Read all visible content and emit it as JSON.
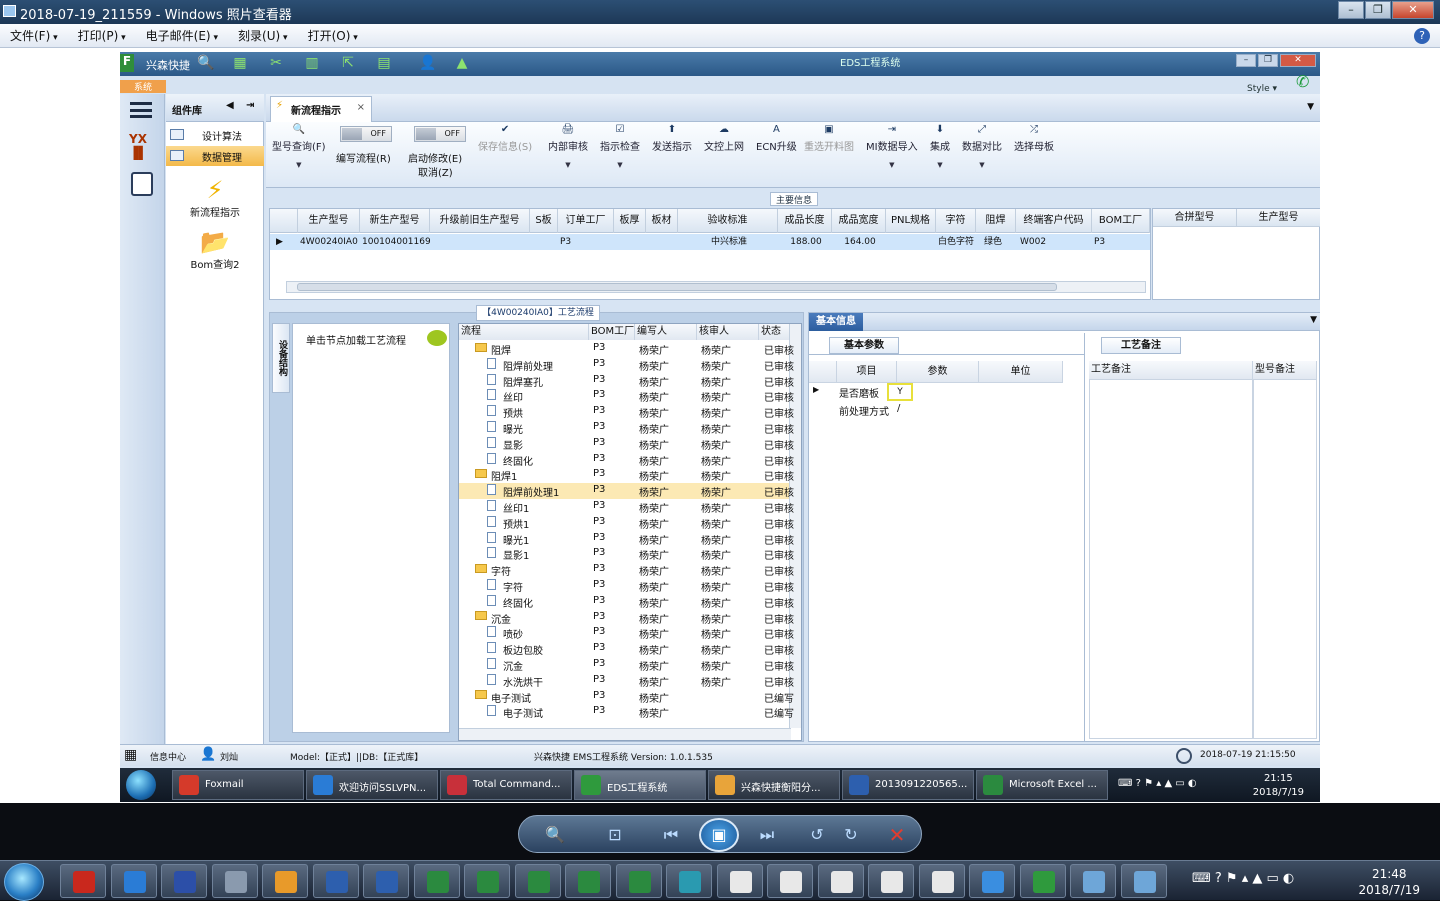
{
  "viewer": {
    "title": "2018-07-19_211559 - Windows 照片查看器",
    "menu": [
      "文件(F)",
      "打印(P)",
      "电子邮件(E)",
      "刻录(U)",
      "打开(O)"
    ]
  },
  "app": {
    "brand": "兴森快捷",
    "window_title": "EDS工程系统",
    "system_tab": "系统",
    "style_label": "Style ▾",
    "component_panel": {
      "title": "组件库",
      "items": [
        "设计算法",
        "数据管理"
      ],
      "shortcuts": [
        "新流程指示",
        "Bom查询2"
      ]
    },
    "doc_tab": "新流程指示",
    "ribbon": {
      "buttons": [
        {
          "label": "型号查询(F)",
          "icon": "🔍"
        },
        {
          "label": "编写流程(R)",
          "toggle": "OFF"
        },
        {
          "label": "启动修改(E)",
          "label2": "取消(Z)",
          "toggle": "OFF"
        },
        {
          "label": "保存信息(S)",
          "icon": "✔",
          "disabled": true
        },
        {
          "label": "内部审核",
          "icon": "🖨"
        },
        {
          "label": "指示检查",
          "icon": "☑"
        },
        {
          "label": "发送指示",
          "icon": "⬆"
        },
        {
          "label": "文控上网",
          "icon": "☁"
        },
        {
          "label": "ECN升级",
          "icon": "A"
        },
        {
          "label": "重选开料图",
          "icon": "▣",
          "disabled": true
        },
        {
          "label": "MI数据导入",
          "icon": "⇥"
        },
        {
          "label": "集成",
          "icon": "⬇"
        },
        {
          "label": "数据对比",
          "icon": "⤢"
        },
        {
          "label": "选择母板",
          "icon": "⤮"
        }
      ]
    },
    "main_info": {
      "title": "主要信息",
      "columns": [
        "生产型号",
        "新生产型号",
        "升级前旧生产型号",
        "S板",
        "订单工厂",
        "板厚",
        "板材",
        "验收标准",
        "成品长度",
        "成品宽度",
        "PNL规格",
        "字符",
        "阻焊",
        "终端客户代码",
        "BOM工厂"
      ],
      "row": [
        "4W00240IA0",
        "10010400116961",
        "",
        "",
        "P3",
        "",
        "",
        "中兴标准",
        "188.00",
        "164.00",
        "",
        "白色字符",
        "绿色",
        "W002",
        "P3"
      ],
      "side_columns": [
        "合拼型号",
        "生产型号"
      ]
    },
    "flow": {
      "title": "【4W00240IA0】工艺流程",
      "vertical_tab": "设备结构",
      "hint": "单击节点加载工艺流程",
      "columns": [
        "流程",
        "BOM工厂",
        "编写人",
        "核审人",
        "状态"
      ],
      "rows": [
        {
          "name": "阻焊",
          "level": 0,
          "folder": true,
          "bom": "P3",
          "writer": "杨荣广",
          "reviewer": "杨荣广",
          "status": "已审核"
        },
        {
          "name": "阻焊前处理",
          "level": 1,
          "bom": "P3",
          "writer": "杨荣广",
          "reviewer": "杨荣广",
          "status": "已审核"
        },
        {
          "name": "阻焊塞孔",
          "level": 1,
          "bom": "P3",
          "writer": "杨荣广",
          "reviewer": "杨荣广",
          "status": "已审核"
        },
        {
          "name": "丝印",
          "level": 1,
          "bom": "P3",
          "writer": "杨荣广",
          "reviewer": "杨荣广",
          "status": "已审核"
        },
        {
          "name": "预烘",
          "level": 1,
          "bom": "P3",
          "writer": "杨荣广",
          "reviewer": "杨荣广",
          "status": "已审核"
        },
        {
          "name": "曝光",
          "level": 1,
          "bom": "P3",
          "writer": "杨荣广",
          "reviewer": "杨荣广",
          "status": "已审核"
        },
        {
          "name": "显影",
          "level": 1,
          "bom": "P3",
          "writer": "杨荣广",
          "reviewer": "杨荣广",
          "status": "已审核"
        },
        {
          "name": "终固化",
          "level": 1,
          "bom": "P3",
          "writer": "杨荣广",
          "reviewer": "杨荣广",
          "status": "已审核"
        },
        {
          "name": "阻焊1",
          "level": 0,
          "folder": true,
          "bom": "P3",
          "writer": "杨荣广",
          "reviewer": "杨荣广",
          "status": "已审核"
        },
        {
          "name": "阻焊前处理1",
          "level": 1,
          "bom": "P3",
          "writer": "杨荣广",
          "reviewer": "杨荣广",
          "status": "已审核",
          "selected": true
        },
        {
          "name": "丝印1",
          "level": 1,
          "bom": "P3",
          "writer": "杨荣广",
          "reviewer": "杨荣广",
          "status": "已审核"
        },
        {
          "name": "预烘1",
          "level": 1,
          "bom": "P3",
          "writer": "杨荣广",
          "reviewer": "杨荣广",
          "status": "已审核"
        },
        {
          "name": "曝光1",
          "level": 1,
          "bom": "P3",
          "writer": "杨荣广",
          "reviewer": "杨荣广",
          "status": "已审核"
        },
        {
          "name": "显影1",
          "level": 1,
          "bom": "P3",
          "writer": "杨荣广",
          "reviewer": "杨荣广",
          "status": "已审核"
        },
        {
          "name": "字符",
          "level": 0,
          "folder": true,
          "bom": "P3",
          "writer": "杨荣广",
          "reviewer": "杨荣广",
          "status": "已审核"
        },
        {
          "name": "字符",
          "level": 1,
          "bom": "P3",
          "writer": "杨荣广",
          "reviewer": "杨荣广",
          "status": "已审核"
        },
        {
          "name": "终固化",
          "level": 1,
          "bom": "P3",
          "writer": "杨荣广",
          "reviewer": "杨荣广",
          "status": "已审核"
        },
        {
          "name": "沉金",
          "level": 0,
          "folder": true,
          "bom": "P3",
          "writer": "杨荣广",
          "reviewer": "杨荣广",
          "status": "已审核"
        },
        {
          "name": "喷砂",
          "level": 1,
          "bom": "P3",
          "writer": "杨荣广",
          "reviewer": "杨荣广",
          "status": "已审核"
        },
        {
          "name": "板边包胶",
          "level": 1,
          "bom": "P3",
          "writer": "杨荣广",
          "reviewer": "杨荣广",
          "status": "已审核"
        },
        {
          "name": "沉金",
          "level": 1,
          "bom": "P3",
          "writer": "杨荣广",
          "reviewer": "杨荣广",
          "status": "已审核"
        },
        {
          "name": "水洗烘干",
          "level": 1,
          "bom": "P3",
          "writer": "杨荣广",
          "reviewer": "杨荣广",
          "status": "已审核"
        },
        {
          "name": "电子测试",
          "level": 0,
          "folder": true,
          "bom": "P3",
          "writer": "杨荣广",
          "reviewer": "",
          "status": "已编写"
        },
        {
          "name": "电子测试",
          "level": 1,
          "bom": "P3",
          "writer": "杨荣广",
          "reviewer": "",
          "status": "已编写"
        }
      ]
    },
    "basic_info": {
      "title": "基本信息",
      "param_tab": "基本参数",
      "param_columns": [
        "项目",
        "参数",
        "单位"
      ],
      "params": [
        {
          "item": "是否磨板",
          "value": "Y",
          "unit": ""
        },
        {
          "item": "前处理方式",
          "value": "/",
          "unit": ""
        }
      ],
      "note_tab": "工艺备注",
      "note_columns": [
        "工艺备注",
        "型号备注"
      ]
    },
    "status_bar": {
      "info_center": "信息中心",
      "user": "刘灿",
      "model_db": "Model:【正式】||DB:【正式库】",
      "version": "兴森快捷 EMS工程系统 Version: 1.0.1.535",
      "datetime": "2018-07-19 21:15:50"
    },
    "taskbar": {
      "items": [
        {
          "label": "Foxmail",
          "color": "#d53a2a"
        },
        {
          "label": "欢迎访问SSLVPN...",
          "color": "#2a7cd6"
        },
        {
          "label": "Total Command...",
          "color": "#c8303a"
        },
        {
          "label": "EDS工程系统",
          "color": "#2f9a3d"
        },
        {
          "label": "兴森快捷衡阳分...",
          "color": "#e8a43a"
        },
        {
          "label": "2013091220565...",
          "color": "#2d5fae"
        },
        {
          "label": "Microsoft Excel ...",
          "color": "#2b8a3f"
        }
      ],
      "time": "21:15",
      "date": "2018/7/19"
    }
  },
  "windows_taskbar": {
    "time": "21:48",
    "date": "2018/7/19",
    "pinned": [
      {
        "name": "foxmail",
        "color": "#c9281d"
      },
      {
        "name": "ie",
        "color": "#2a7cd6"
      },
      {
        "name": "total-commander",
        "color": "#2c4fa8"
      },
      {
        "name": "keyboard-app",
        "color": "#8a9aae"
      },
      {
        "name": "shell-app",
        "color": "#e89a2a"
      },
      {
        "name": "word-1",
        "color": "#2d5fae"
      },
      {
        "name": "word-2",
        "color": "#2d5fae"
      },
      {
        "name": "excel-1",
        "color": "#2b8a3f"
      },
      {
        "name": "excel-2",
        "color": "#2b8a3f"
      },
      {
        "name": "excel-3",
        "color": "#2b8a3f"
      },
      {
        "name": "excel-4",
        "color": "#2b8a3f"
      },
      {
        "name": "excel-5",
        "color": "#2b8a3f"
      },
      {
        "name": "eye-app",
        "color": "#2a9ab0"
      },
      {
        "name": "excel-window-1",
        "color": "#e8e8e8"
      },
      {
        "name": "excel-window-2",
        "color": "#e8e8e8"
      },
      {
        "name": "excel-window-3",
        "color": "#e8e8e8"
      },
      {
        "name": "excel-window-4",
        "color": "#e8e8e8"
      },
      {
        "name": "excel-window-5",
        "color": "#e8e8e8"
      },
      {
        "name": "bird-app",
        "color": "#3a8ee0"
      },
      {
        "name": "eds-app",
        "color": "#2f9a3d"
      },
      {
        "name": "photo-viewer-1",
        "color": "#6ea6d8"
      },
      {
        "name": "photo-viewer-2",
        "color": "#6ea6d8"
      }
    ]
  }
}
